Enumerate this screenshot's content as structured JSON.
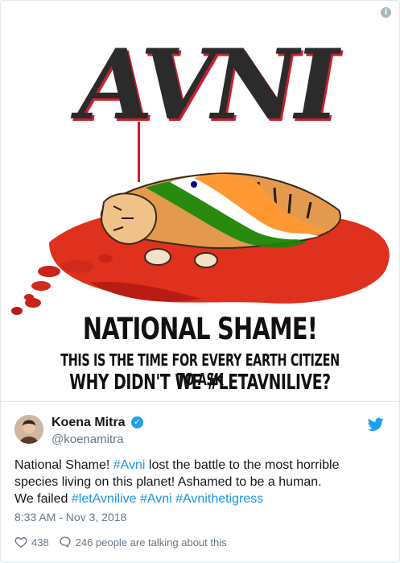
{
  "poster": {
    "title": "AVNI",
    "headline": "NATIONAL SHAME!",
    "subline": "THIS IS THE TIME FOR EVERY EARTH CITIZEN TO ASK",
    "question": "WHY DIDN'T WE #LETAVNILIVE?",
    "accent_red": "#c8202e",
    "blood_red": "#e0301e"
  },
  "tweet": {
    "display_name": "Koena Mitra",
    "handle": "@koenamitra",
    "text_part1": "National Shame!  ",
    "tag_avni": "#Avni",
    "text_part2": " lost the battle to the most horrible species living on this planet! Ashamed to be a human.",
    "text_part3": "We failed ",
    "tag_letavnilive": "#letAvnilive",
    "tag_avni2": "#Avni",
    "tag_avnithetigress": "#Avnithetigress",
    "timestamp": "8:33 AM - Nov 3, 2018",
    "like_count": "438",
    "talking_text": "246 people are talking about this",
    "link_color": "#1b95e0",
    "verified_color": "#1da1f2"
  },
  "icons": {
    "info": "i",
    "verified": "✓"
  }
}
